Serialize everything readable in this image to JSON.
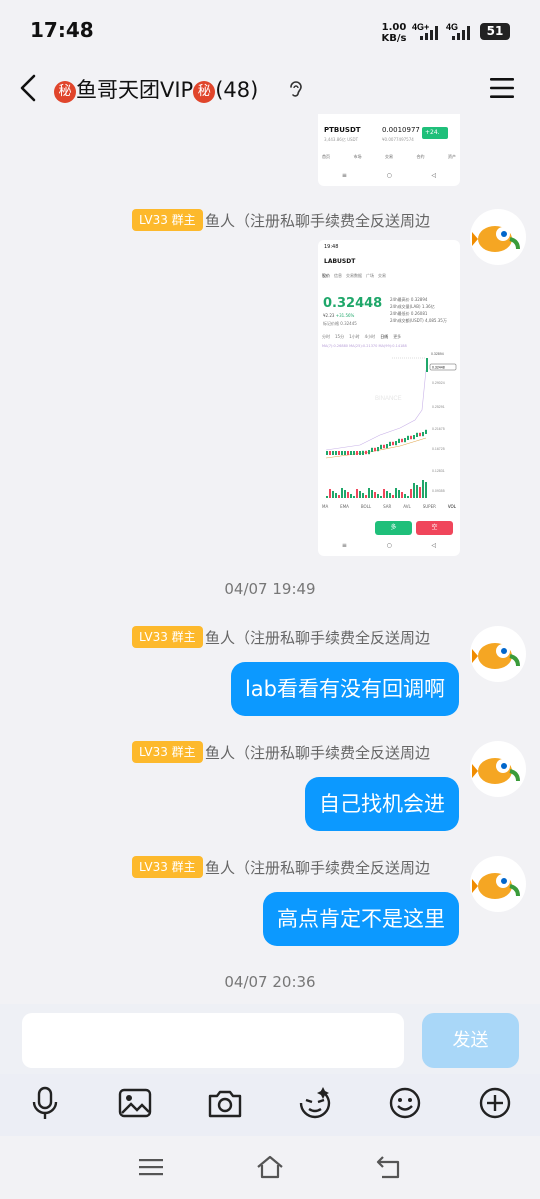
{
  "status_bar": {
    "time": "17:48",
    "net_speed_value": "1.00",
    "net_speed_unit": "KB/s",
    "signal1_label": "4G+",
    "signal2_label": "4G",
    "battery": "51"
  },
  "header": {
    "seal_char": "秘",
    "title": "鱼哥天团VIP",
    "member_count": "(48)"
  },
  "shot1": {
    "symbol": "PTBUSDT",
    "price": "0.0010977",
    "change": "+24.",
    "sub": "3,443.86亿 USDT",
    "sub2": "¥0.0077497574",
    "tabs": [
      "首页",
      "市场",
      "交易",
      "合约",
      "资产"
    ]
  },
  "shot2": {
    "time": "19:48",
    "symbol": "LABUSDT",
    "tabs": [
      "股价",
      "信息",
      "交易数据",
      "广场",
      "交易"
    ],
    "price": "0.32448",
    "cny": "¥2.23",
    "change": "+31.56%",
    "mark_price": "标记价格 0.32445",
    "stats": [
      "24h最高价 0.32894",
      "24h成交量(LAB) 1.36亿",
      "24h最低价 0.26081",
      "24h成交额(USDT) 4,085.35万"
    ],
    "ranges": [
      "分时",
      "15分",
      "1小时",
      "4小时",
      "日线",
      "更多"
    ],
    "ma_text": "MA(7):0.26880  MA(25):0.21370  MA(99):0.14188",
    "price_labels": [
      "0.32894",
      "0.32448",
      "0.29024",
      "0.25291",
      "0.21675",
      "0.16725",
      "0.12831",
      "0.09355"
    ],
    "indicators": [
      "MA",
      "EMA",
      "BOLL",
      "SAR",
      "AVL",
      "SUPER",
      "VOL"
    ],
    "buy": "多",
    "sell": "空",
    "watermark": "BINANCE"
  },
  "messages": [
    {
      "level_badge": "LV33 群主",
      "sender": "鱼人（注册私聊手续费全反送周边"
    },
    {
      "timestamp": "04/07 19:49"
    },
    {
      "level_badge": "LV33 群主",
      "sender": "鱼人（注册私聊手续费全反送周边",
      "text": "lab看看有没有回调啊"
    },
    {
      "level_badge": "LV33 群主",
      "sender": "鱼人（注册私聊手续费全反送周边",
      "text": "自己找机会进"
    },
    {
      "level_badge": "LV33 群主",
      "sender": "鱼人（注册私聊手续费全反送周边",
      "text": "高点肯定不是这里"
    },
    {
      "timestamp": "04/07 20:36"
    }
  ],
  "input": {
    "placeholder": "",
    "send_label": "发送"
  },
  "toolbar_icons": [
    "microphone-icon",
    "image-icon",
    "camera-icon",
    "sticker-icon",
    "emoji-icon",
    "plus-icon"
  ],
  "nav_icons": [
    "menu-icon",
    "home-icon",
    "back-icon"
  ]
}
